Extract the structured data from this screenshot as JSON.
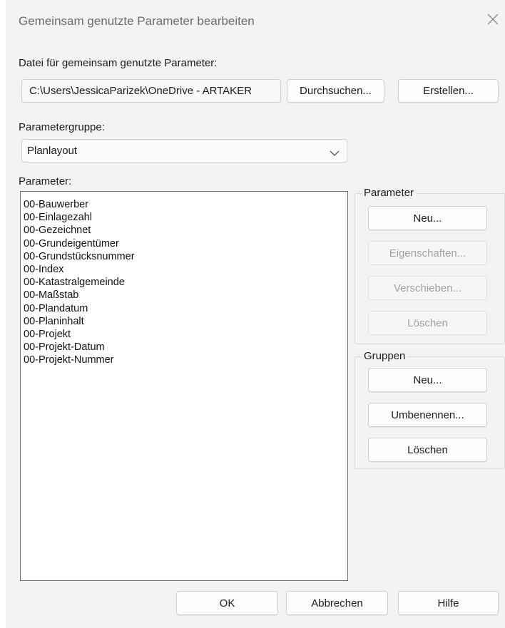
{
  "dialog": {
    "title": "Gemeinsam genutzte Parameter bearbeiten",
    "close_icon": "close-icon"
  },
  "file": {
    "label": "Datei für gemeinsam genutzte Parameter:",
    "path": "C:\\Users\\JessicaParizek\\OneDrive - ARTAKER",
    "browse_label": "Durchsuchen...",
    "create_label": "Erstellen..."
  },
  "group_select": {
    "label": "Parametergruppe:",
    "value": "Planlayout",
    "icon": "chevron-down-icon"
  },
  "parameters": {
    "label": "Parameter:",
    "items": [
      "00-Bauwerber",
      "00-Einlagezahl",
      "00-Gezeichnet",
      "00-Grundeigentümer",
      "00-Grundstücksnummer",
      "00-Index",
      "00-Katastralgemeinde",
      "00-Maßstab",
      "00-Plandatum",
      "00-Planinhalt",
      "00-Projekt",
      "00-Projekt-Datum",
      "00-Projekt-Nummer"
    ]
  },
  "param_box": {
    "legend": "Parameter",
    "new_label": "Neu...",
    "props_label": "Eigenschaften...",
    "move_label": "Verschieben...",
    "delete_label": "Löschen"
  },
  "groups_box": {
    "legend": "Gruppen",
    "new_label": "Neu...",
    "rename_label": "Umbenennen...",
    "delete_label": "Löschen"
  },
  "footer": {
    "ok_label": "OK",
    "cancel_label": "Abbrechen",
    "help_label": "Hilfe"
  }
}
